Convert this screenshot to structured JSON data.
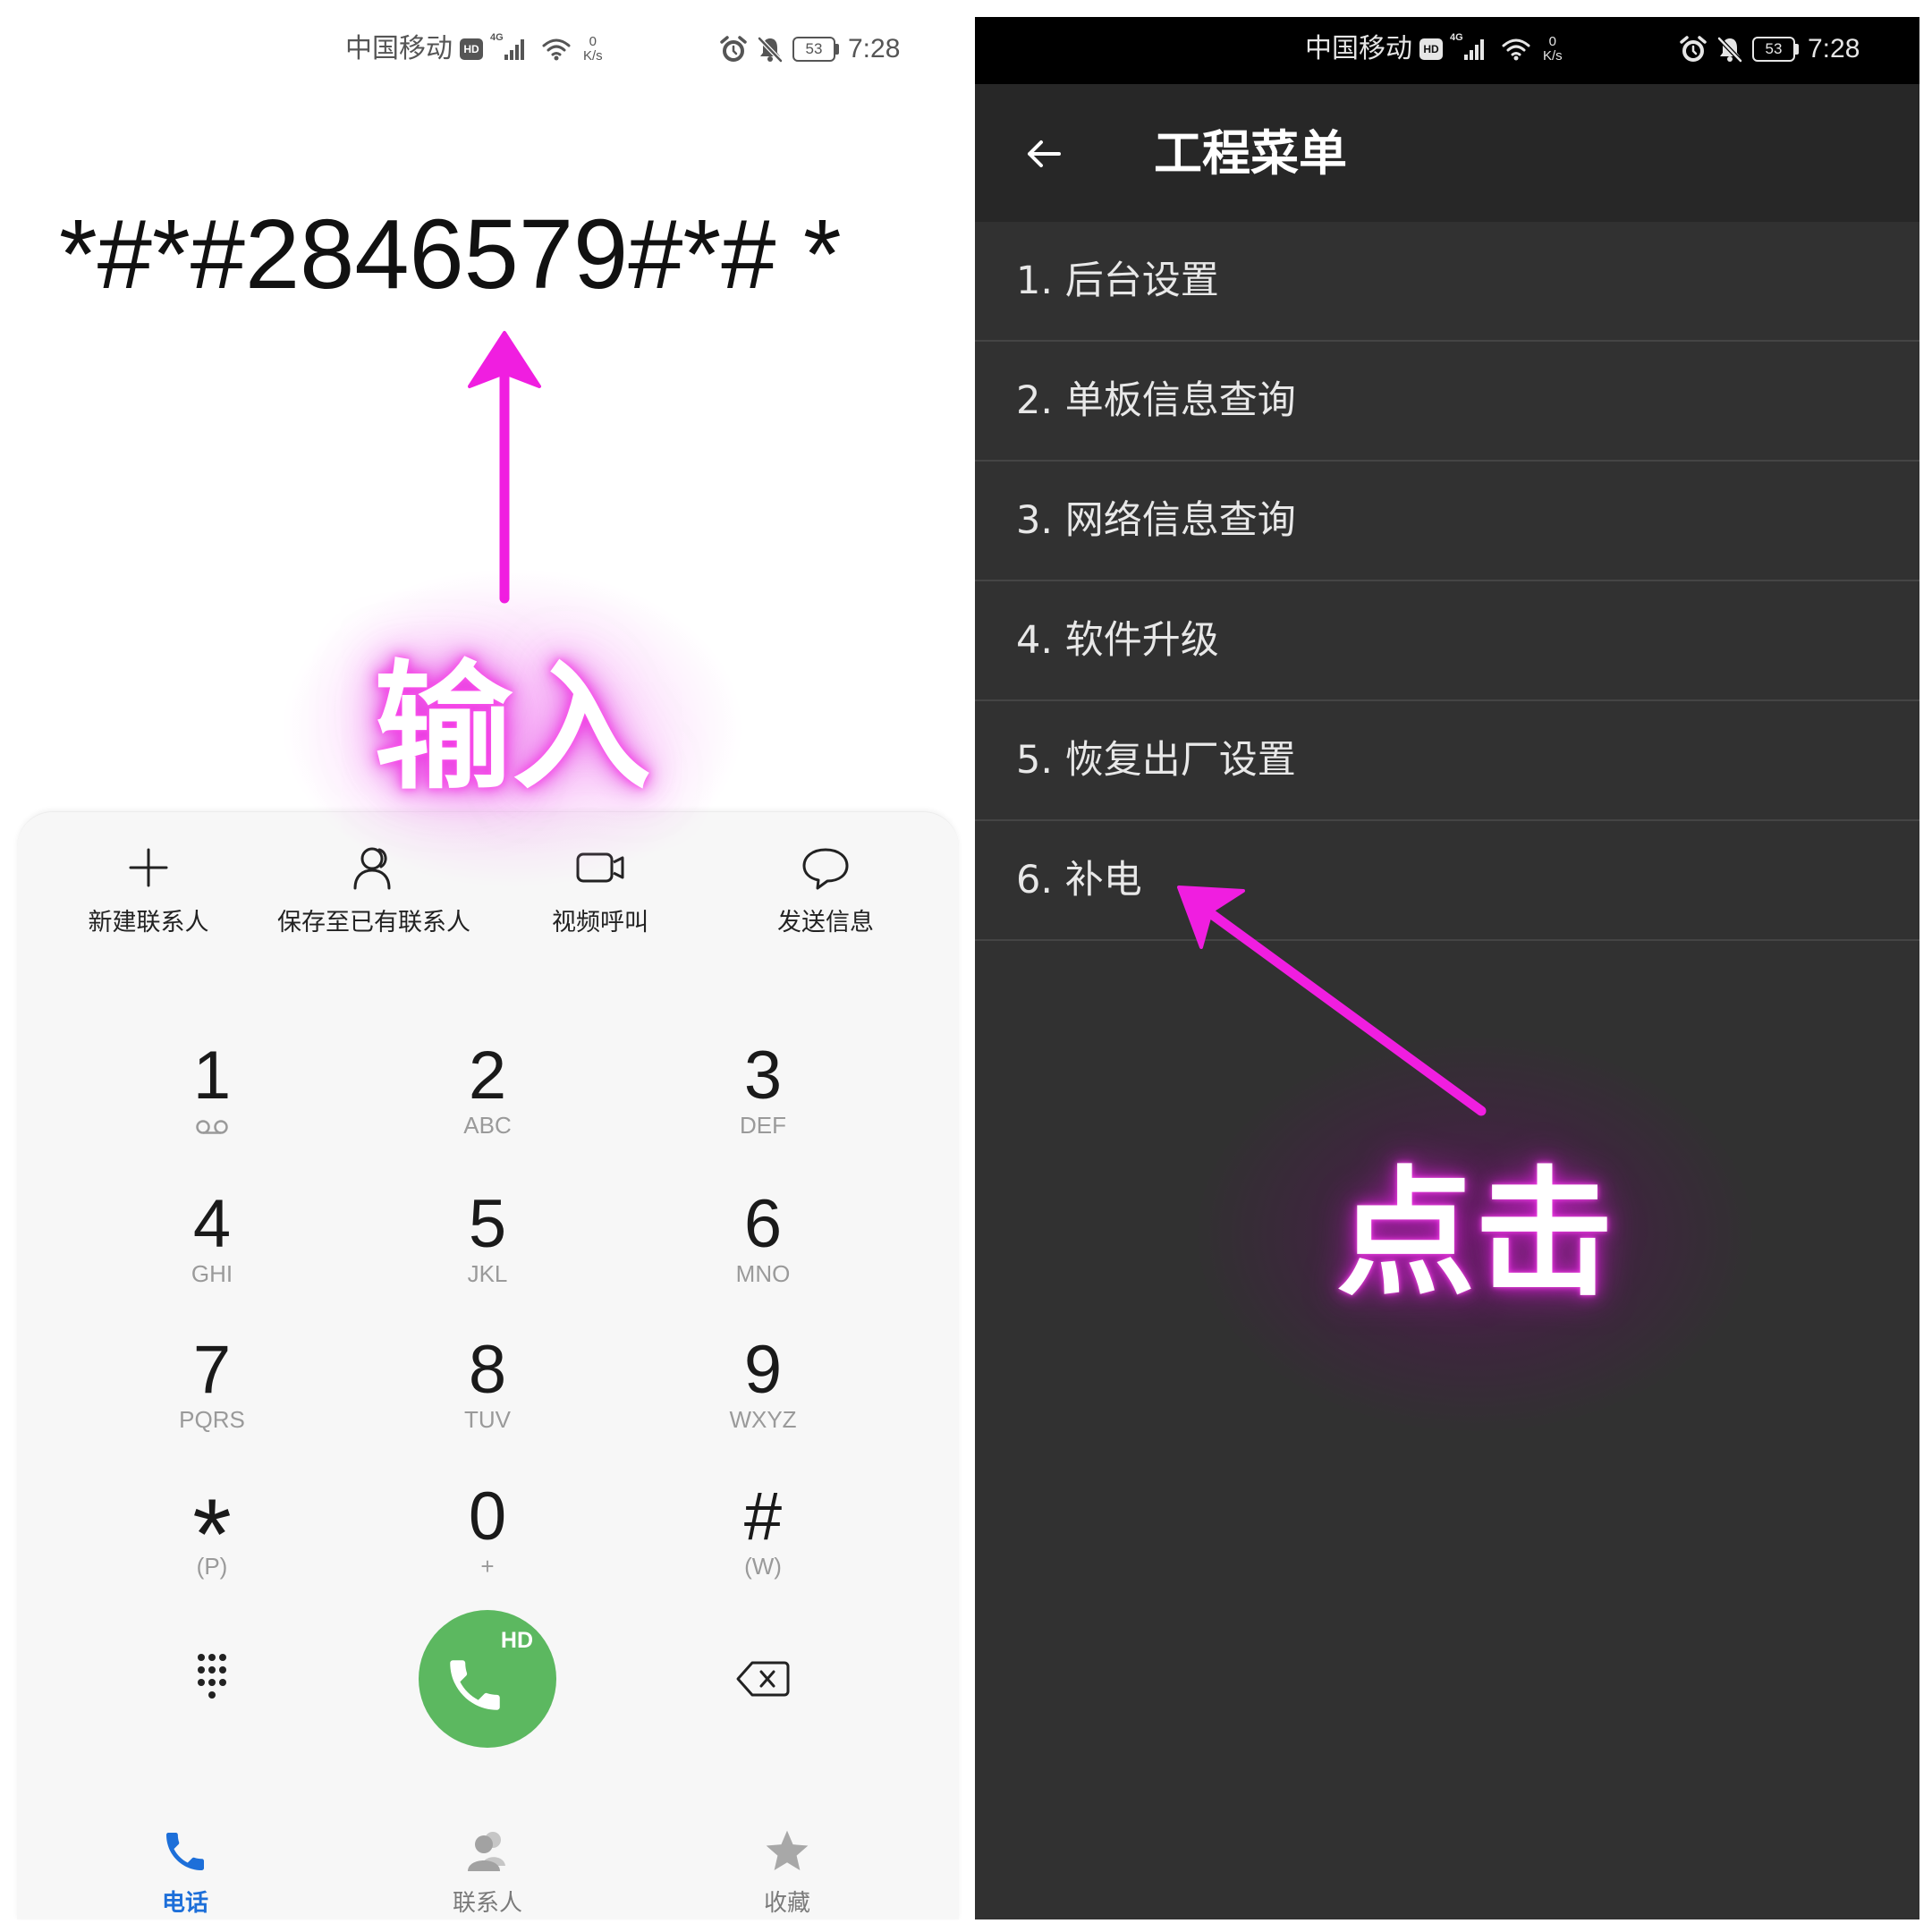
{
  "status_bar": {
    "carrier": "中国移动",
    "hd_badge": "HD",
    "network_type": "4G",
    "speed_value": "0",
    "speed_unit": "K/s",
    "battery_level": "53",
    "time": "7:28"
  },
  "dialer": {
    "dialed_number": "*#*#2846579#*# *",
    "actions": [
      {
        "label": "新建联系人",
        "icon": "plus-icon"
      },
      {
        "label": "保存至已有联系人",
        "icon": "person-icon"
      },
      {
        "label": "视频呼叫",
        "icon": "video-call-icon"
      },
      {
        "label": "发送信息",
        "icon": "message-icon"
      }
    ],
    "keys": [
      {
        "digit": "1",
        "sub_icon": "voicemail-icon"
      },
      {
        "digit": "2",
        "sub": "ABC"
      },
      {
        "digit": "3",
        "sub": "DEF"
      },
      {
        "digit": "4",
        "sub": "GHI"
      },
      {
        "digit": "5",
        "sub": "JKL"
      },
      {
        "digit": "6",
        "sub": "MNO"
      },
      {
        "digit": "7",
        "sub": "PQRS"
      },
      {
        "digit": "8",
        "sub": "TUV"
      },
      {
        "digit": "9",
        "sub": "WXYZ"
      },
      {
        "digit": "*",
        "sub": "(P)"
      },
      {
        "digit": "0",
        "sub": "+"
      },
      {
        "digit": "#",
        "sub": "(W)"
      }
    ],
    "call_button": {
      "badge": "HD",
      "icon": "phone-icon"
    },
    "nav": [
      {
        "label": "电话",
        "icon": "phone-icon",
        "active": true
      },
      {
        "label": "联系人",
        "icon": "contacts-icon",
        "active": false
      },
      {
        "label": "收藏",
        "icon": "star-icon",
        "active": false
      }
    ]
  },
  "engineering_menu": {
    "title": "工程菜单",
    "back_icon": "back-arrow-icon",
    "items": [
      "1. 后台设置",
      "2. 单板信息查询",
      "3. 网络信息查询",
      "4. 软件升级",
      "5. 恢复出厂设置",
      "6. 补电"
    ]
  },
  "annotations": {
    "input_label": "输入",
    "click_label": "点击"
  },
  "colors": {
    "annotation_magenta": "#f01ee0",
    "call_green": "#5cb860",
    "nav_active_blue": "#1d6fd9",
    "menu_background": "#313131",
    "toolbar_background": "#272727"
  }
}
